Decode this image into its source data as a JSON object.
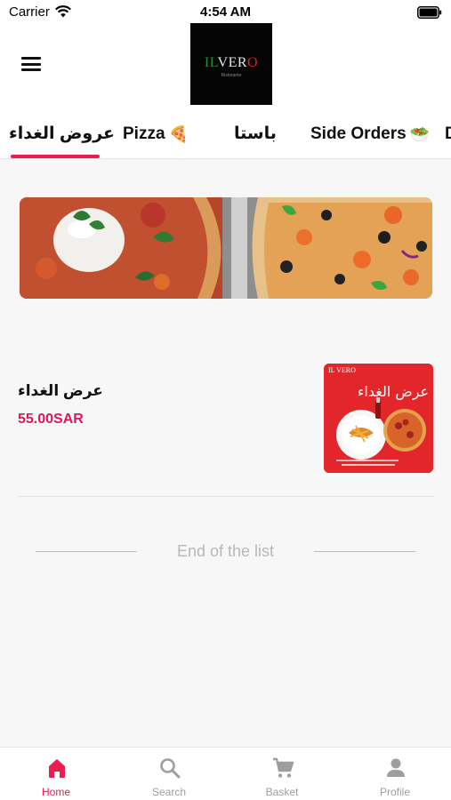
{
  "status_bar": {
    "carrier": "Carrier",
    "time": "4:54 AM"
  },
  "header": {
    "logo": {
      "il": "IL",
      "ver": "VER",
      "o": "O",
      "tagline": "Ristorante"
    }
  },
  "tabs": [
    {
      "label": "عروض الغداء",
      "emoji": "",
      "active": true
    },
    {
      "label": "Pizza",
      "emoji": "🍕",
      "active": false
    },
    {
      "label": "باستا",
      "emoji": "",
      "active": false
    },
    {
      "label": "Side Orders",
      "emoji": "🥗",
      "active": false
    },
    {
      "label": "D",
      "emoji": "",
      "active": false
    }
  ],
  "menu_items": [
    {
      "title": "عرض الغداء",
      "price": "55.00SAR",
      "image": {
        "brand": "IL VERO",
        "heading": "عرض الغداء"
      }
    }
  ],
  "end_of_list": "End of the list",
  "bottom_nav": [
    {
      "label": "Home",
      "icon": "home-icon",
      "active": true
    },
    {
      "label": "Search",
      "icon": "search-icon",
      "active": false
    },
    {
      "label": "Basket",
      "icon": "cart-icon",
      "active": false
    },
    {
      "label": "Profile",
      "icon": "profile-icon",
      "active": false
    }
  ],
  "colors": {
    "accent": "#e91e4d",
    "price": "#e0185a",
    "inactive": "#9e9e9e"
  }
}
